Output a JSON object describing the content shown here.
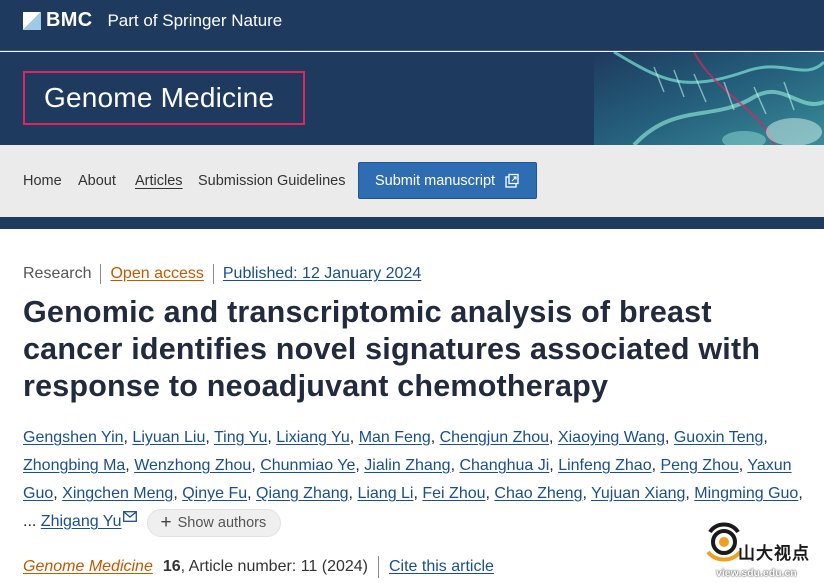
{
  "header": {
    "brand": "BMC",
    "brand_tagline": "Part of Springer Nature",
    "journal_name": "Genome Medicine"
  },
  "nav": {
    "items": [
      "Home",
      "About",
      "Articles",
      "Submission Guidelines"
    ],
    "active": "Articles",
    "submit_label": "Submit manuscript"
  },
  "article": {
    "type": "Research",
    "access": "Open access",
    "published": "Published: 12 January 2024",
    "title": "Genomic and transcriptomic analysis of breast cancer identifies novel signatures associated with response to neoadjuvant chemotherapy",
    "authors": [
      "Gengshen Yin",
      "Liyuan Liu",
      "Ting Yu",
      "Lixiang Yu",
      "Man Feng",
      "Chengjun Zhou",
      "Xiaoying Wang",
      "Guoxin Teng",
      "Zhongbing Ma",
      "Wenzhong Zhou",
      "Chunmiao Ye",
      "Jialin Zhang",
      "Changhua Ji",
      "Linfeng Zhao",
      "Peng Zhou",
      "Yaxun Guo",
      "Xingchen Meng",
      "Qinye Fu",
      "Qiang Zhang",
      "Liang Li",
      "Fei Zhou",
      "Chao Zheng",
      "Yujuan Xiang",
      "Mingming Guo"
    ],
    "ellipsis": "...",
    "last_author": "Zhigang Yu",
    "show_authors_label": "Show authors",
    "journal_citation": "Genome Medicine",
    "volume": "16",
    "article_number": ", Article number: 11 (2024)",
    "cite_label": "Cite this article"
  },
  "watermark": {
    "text": "山大视点",
    "url": "view.sdu.edu.cn"
  },
  "colors": {
    "header_bg": "#1e3a5f",
    "journal_border": "#e0245e",
    "link": "#1b4f8c",
    "open_access": "#c05a00",
    "submit_bg": "#2f6db3"
  }
}
